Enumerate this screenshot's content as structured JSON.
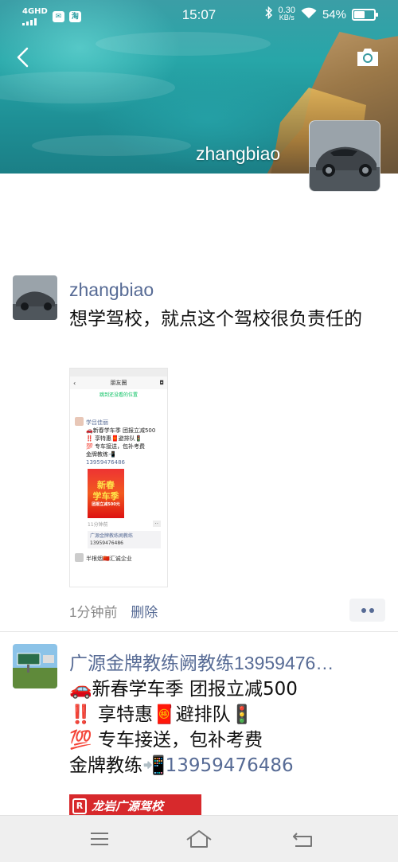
{
  "status_bar": {
    "network": "4GHD",
    "time": "15:07",
    "speed_value": "0.30",
    "speed_unit": "KB/s",
    "battery": "54%",
    "battery_level": 0.54
  },
  "header": {
    "username": "zhangbiao"
  },
  "posts": [
    {
      "author": "zhangbiao",
      "text": "想学驾校，就点这个驾校很负责任的",
      "shared_screenshot": {
        "nav_title": "朋友圈",
        "notice": "跳到还没看的位置",
        "inner_author": "学吕佳丽",
        "inner_lines": [
          "🚗新春学车季 团报立减500",
          "‼️ 享特惠🧧避排队🚦",
          "💯 专车接送，包补考费",
          "金牌教练📲"
        ],
        "inner_phone": "13959476486",
        "poster_title_1": "新春",
        "poster_title_2": "学车季",
        "poster_sub": "团报立减500元",
        "inner_time": "11分钟前",
        "inner_dots": "··",
        "comment_author": "广源金牌教练阙教练",
        "comment_phone": "13959476486",
        "next_author": "半根烟🇨🇳汇诚企业"
      },
      "time": "1分钟前",
      "delete_label": "删除"
    },
    {
      "author": "广源金牌教练阙教练13959476…",
      "line1": "🚗新春学车季 团报立减500",
      "line2": "‼️ 享特惠🧧避排队🚦",
      "line3": "💯 专车接送，包补考费",
      "line4_prefix": "金牌教练📲",
      "phone": "13959476486",
      "banner_logo": "R",
      "banner_text": "龙岩广源驾校"
    }
  ],
  "colors": {
    "link_blue": "#576b95",
    "cover_teal": "#27a6a8",
    "banner_red": "#d7292c"
  },
  "icons": [
    "back-icon",
    "camera-icon",
    "more-dots-icon",
    "menu-icon",
    "home-icon",
    "return-icon"
  ]
}
